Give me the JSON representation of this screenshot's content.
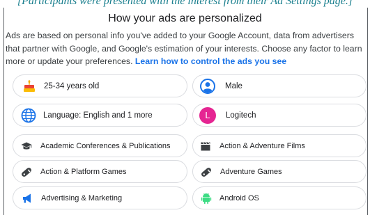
{
  "caption": "[Participants were presented with the interest from their Ad Settings page.]",
  "title": "How your ads are personalized",
  "description": {
    "text": "Ads are based on personal info you've added to your Google Account, data from advertisers that partner with Google, and Google's estimation of your interests. Choose any factor to learn more or update your preferences. ",
    "link": "Learn how to control the ads you see"
  },
  "factors": {
    "age": "25-34 years old",
    "gender": "Male",
    "language": "Language: English and 1 more",
    "brand": "Logitech",
    "brand_initial": "L",
    "interests": [
      "Academic Conferences & Publications",
      "Action & Adventure Films",
      "Action & Platform Games",
      "Adventure Games",
      "Advertising & Marketing",
      "Android OS"
    ]
  },
  "icons": {
    "age": "birthday-cake-icon",
    "gender": "person-icon",
    "language": "globe-icon",
    "brand": "letter-avatar-icon",
    "interests": [
      "graduation-cap-icon",
      "clapperboard-icon",
      "gamepad-icon",
      "gamepad-icon",
      "megaphone-icon",
      "android-icon"
    ]
  },
  "colors": {
    "link": "#1a73e8",
    "brand_avatar": "#e52592",
    "person_icon": "#1a73e8",
    "android": "#3ddc84",
    "caption": "#1a7f8e"
  }
}
